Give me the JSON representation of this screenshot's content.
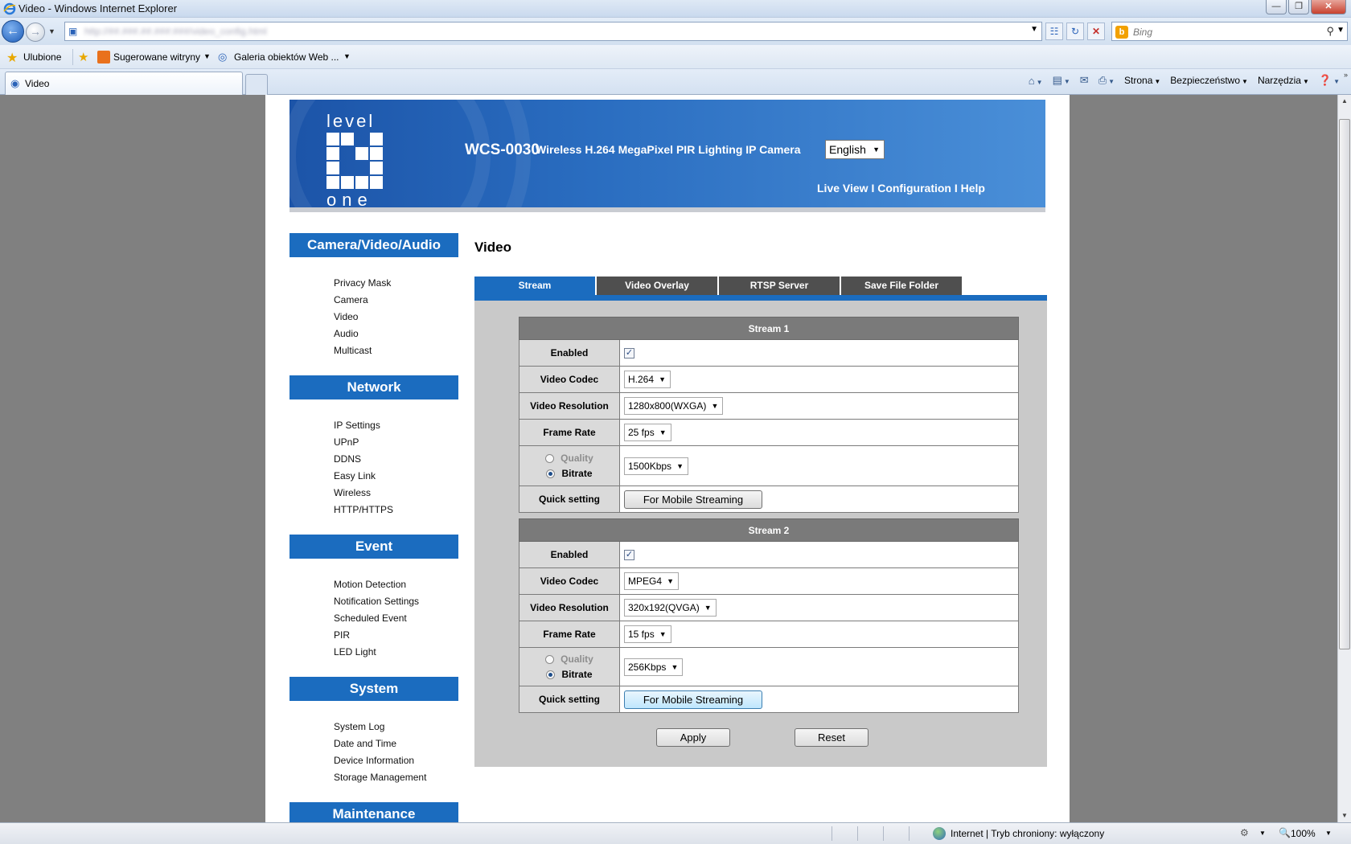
{
  "browser": {
    "window_title": "Video - Windows Internet Explorer",
    "search_placeholder": "Bing",
    "favorites_label": "Ulubione",
    "fav_links": [
      "Sugerowane witryny",
      "Galeria obiektów Web ..."
    ],
    "tab_title": "Video",
    "commands": [
      "Strona",
      "Bezpieczeństwo",
      "Narzędzia"
    ],
    "status_zone": "Internet | Tryb chroniony: wyłączony",
    "zoom": "100%"
  },
  "header": {
    "logo_top": "level",
    "logo_bottom": "one",
    "model": "WCS-0030",
    "description": "Wireless H.264 MegaPixel PIR Lighting IP Camera",
    "language": "English",
    "links_text": "Live View I Configuration I Help"
  },
  "sidebar": {
    "sections": [
      {
        "title": "Camera/Video/Audio",
        "items": [
          "Privacy Mask",
          "Camera",
          "Video",
          "Audio",
          "Multicast"
        ]
      },
      {
        "title": "Network",
        "items": [
          "IP Settings",
          "UPnP",
          "DDNS",
          "Easy Link",
          "Wireless",
          "HTTP/HTTPS"
        ]
      },
      {
        "title": "Event",
        "items": [
          "Motion Detection",
          "Notification Settings",
          "Scheduled Event",
          "PIR",
          "LED Light"
        ]
      },
      {
        "title": "System",
        "items": [
          "System Log",
          "Date and Time",
          "Device Information",
          "Storage Management"
        ]
      },
      {
        "title": "Maintenance",
        "items": []
      }
    ]
  },
  "content": {
    "title": "Video",
    "tabs": [
      "Stream",
      "Video Overlay",
      "RTSP Server",
      "Save File Folder"
    ],
    "active_tab": "Stream",
    "labels": {
      "enabled": "Enabled",
      "codec": "Video Codec",
      "resolution": "Video Resolution",
      "frame_rate": "Frame Rate",
      "quality": "Quality",
      "bitrate": "Bitrate",
      "quick": "Quick setting"
    },
    "streams": [
      {
        "name": "Stream 1",
        "enabled": true,
        "codec": "H.264",
        "resolution": "1280x800(WXGA)",
        "frame_rate": "25 fps",
        "rate_mode": "Bitrate",
        "bitrate": "1500Kbps",
        "quick_button": "For Mobile Streaming"
      },
      {
        "name": "Stream 2",
        "enabled": true,
        "codec": "MPEG4",
        "resolution": "320x192(QVGA)",
        "frame_rate": "15 fps",
        "rate_mode": "Bitrate",
        "bitrate": "256Kbps",
        "quick_button": "For Mobile Streaming"
      }
    ],
    "apply_label": "Apply",
    "reset_label": "Reset"
  }
}
